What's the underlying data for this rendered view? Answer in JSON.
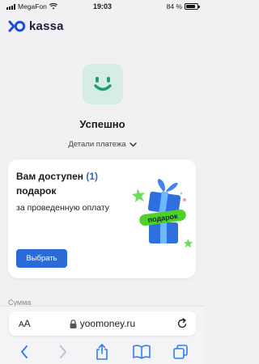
{
  "status_bar": {
    "carrier": "MegaFon",
    "time": "19:03",
    "battery_percent": "84 %",
    "battery_level": 0.84
  },
  "brand": {
    "name": "kassa",
    "logo_icon": "yoo-logo-icon",
    "color": "#1b1f3b"
  },
  "payment": {
    "status_title": "Успешно",
    "details_label": "Детали платежа",
    "success_color": "#d6ece6",
    "smile_color": "#1e9e6a"
  },
  "gift_card": {
    "title_prefix": "Вам доступен",
    "count": "(1)",
    "title_suffix": "подарок",
    "subtitle": "за проведенную оплату",
    "button_label": "Выбрать",
    "ribbon_label": "подарок",
    "accent_color": "#3a66c4",
    "button_color": "#2c6bd7"
  },
  "sum_label": "Сумма",
  "browser": {
    "aa_label_small": "A",
    "aa_label_big": "A",
    "domain": "yoomoney.ru",
    "lock_icon": "lock-icon",
    "reload_icon": "reload-icon",
    "toolbar": [
      "back-icon",
      "forward-icon",
      "share-icon",
      "bookmarks-icon",
      "tabs-icon"
    ]
  }
}
